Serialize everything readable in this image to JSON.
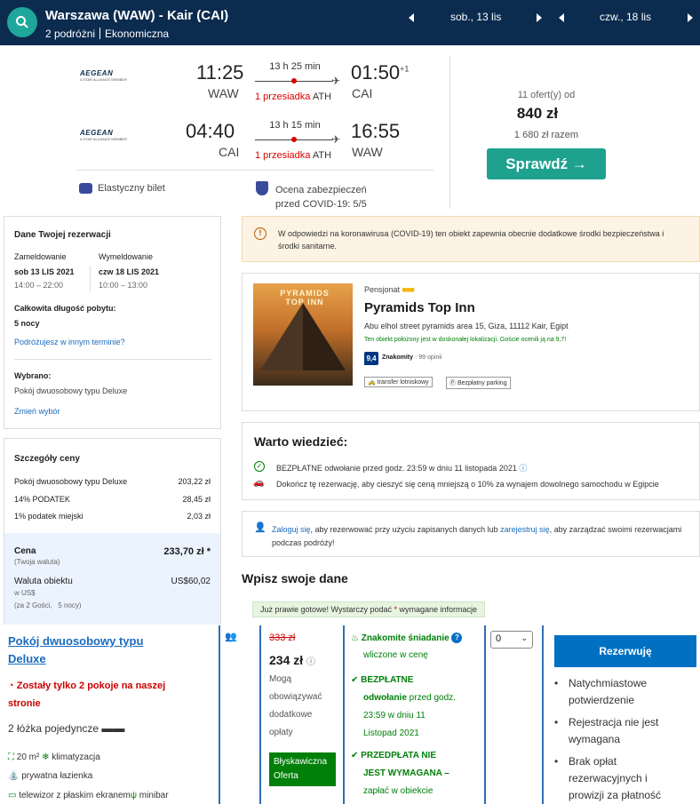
{
  "header": {
    "route": "Warszawa (WAW) - Kair (CAI)",
    "passengers": "2 podróżni",
    "cabin": "Ekonomiczna",
    "depart_date": "sob., 13 lis",
    "return_date": "czw., 18 lis"
  },
  "flight": {
    "airline": "AEGEAN",
    "airline_sub": "A STAR ALLIANCE MEMBER",
    "outbound": {
      "dep_time": "11:25",
      "dep_code": "WAW",
      "duration": "13 h 25 min",
      "stops": "1 przesiadka",
      "stop_airport": "ATH",
      "arr_time": "01:50",
      "arr_plus": "+1",
      "arr_code": "CAI"
    },
    "inbound": {
      "dep_time": "04:40",
      "dep_code": "CAI",
      "duration": "13 h 15 min",
      "stops": "1 przesiadka",
      "stop_airport": "ATH",
      "arr_time": "16:55",
      "arr_code": "WAW"
    },
    "flex_label": "Elastyczny bilet",
    "covid_label_1": "Ocena zabezpieczeń",
    "covid_label_2": "przed COVID-19: 5/5",
    "offers": "11 ofert(y) od",
    "price": "840 zł",
    "total": "1 680 zł razem",
    "check_button": "Sprawdź →"
  },
  "booking": {
    "title": "Dane Twojej rezerwacji",
    "checkin_label": "Zameldowanie",
    "checkin_date": "sob 13 LIS 2021",
    "checkin_time": "14:00 – 22:00",
    "checkout_label": "Wymeldowanie",
    "checkout_date": "czw 18 LIS 2021",
    "checkout_time": "10:00 – 13:00",
    "stay_label": "Całkowita długość pobytu:",
    "stay_value": "5 nocy",
    "other_dates": "Podróżujesz w innym terminie?",
    "selected_label": "Wybrano:",
    "selected_value": "Pokój dwuosobowy typu Deluxe",
    "change_link": "Zmień wybór"
  },
  "price_details": {
    "title": "Szczegóły ceny",
    "rows": [
      {
        "label": "Pokój dwuosobowy typu Deluxe",
        "value": "203,22 zł"
      },
      {
        "label": "14% PODATEK",
        "value": "28,45 zł"
      },
      {
        "label": "1% podatek miejski",
        "value": "2,03 zł"
      }
    ],
    "total_label": "Cena",
    "total_sub": "(Twoja waluta)",
    "total_value": "233,70 zł *",
    "currency_label": "Waluta obiektu",
    "currency_sub1": "w US$",
    "currency_sub2": "(za 2 Gości,   5 nocy)",
    "currency_value": "US$60,02"
  },
  "hotel": {
    "covid_notice": "W odpowiedzi na koronawirusa (COVID-19) ten obiekt zapewnia obecnie dodatkowe środki bezpieczeństwa i środki sanitarne.",
    "type": "Pensjonat",
    "name": "Pyramids Top Inn",
    "image_text": "PYRAMIDS TOP INN",
    "address": "Abu elhol street pyramids area 15, Giza, 11112 Kair, Egipt",
    "location_note": "Ten obiekt położony jest w doskonałej lokalizacji. Goście ocenili ją na 9,7!",
    "score": "9,4",
    "score_label": "Znakomity",
    "reviews": "· 99 opinii",
    "amenity1": "transfer lotniskowy",
    "amenity2": "Bezpłatny parking"
  },
  "good_to_know": {
    "title": "Warto wiedzieć:",
    "item1": "BEZPŁATNE odwołanie przed godz. 23:59 w dniu 11 listopada 2021",
    "item2": "Dokończ tę rezerwację, aby cieszyć się ceną mniejszą o 10% za wynajem dowolnego samochodu w Egipcie"
  },
  "login": {
    "link1": "Zaloguj się",
    "text1": ", aby rezerwować przy użyciu zapisanych danych lub ",
    "link2": "zarejestruj się",
    "text2": ", aby zarządzać swoimi rezerwacjami podczas podróży!"
  },
  "form": {
    "title": "Wpisz swoje dane",
    "almost_ready_1": "Już prawie gotowe! Wystarczy podać ",
    "almost_ready_star": "*",
    "almost_ready_2": " wymagane informacje"
  },
  "room": {
    "name_line1": "Pokój dwuosobowy typu",
    "name_line2": "Deluxe",
    "scarcity_line1": "Zostały tylko 2 pokoje na naszej",
    "scarcity_line2": "stronie",
    "beds": "2 łóżka pojedyncze",
    "size": "20 m²",
    "ac": "klimatyzacja",
    "bathroom": "prywatna łazienka",
    "tv": "telewizor z płaskim ekranem",
    "minibar": "minibar",
    "old_price": "333 zł",
    "new_price": "234 zł",
    "tax_note": [
      "Mogą",
      "obowiązywać",
      "dodatkowe",
      "opłaty"
    ],
    "deal_badge_1": "Błyskawiczna",
    "deal_badge_2": "Oferta",
    "breakfast_title": "Znakomite śniadanie",
    "breakfast_sub": "wliczone w cenę",
    "cancel_1": "BEZPŁATNE",
    "cancel_2b": "odwołanie",
    "cancel_2": " przed godz.",
    "cancel_3": "23:59 w dniu 11",
    "cancel_4": "Listopad 2021",
    "prepay_1": "PRZEDPŁATA NIE",
    "prepay_2": "JEST WYMAGANA –",
    "prepay_3": "zapłać w obiekcie",
    "qty_value": "0",
    "book_button": "Rezerwuję",
    "bullets": [
      [
        "Natychmiastowe",
        "potwierdzenie"
      ],
      [
        "Rejestracja nie jest",
        "wymagana"
      ],
      [
        "Brak opłat",
        "rezerwacyjnych i",
        "prowizji za płatność"
      ]
    ]
  },
  "colors": {
    "navy": "#0b2b4f",
    "teal": "#1fa79b",
    "link": "#1a6bbf",
    "green": "#008009",
    "blue_btn": "#0071c2"
  }
}
